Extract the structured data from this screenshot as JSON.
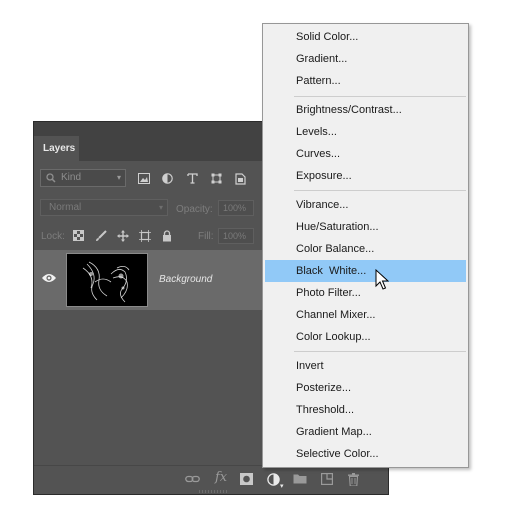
{
  "layers_panel": {
    "tab_label": "Layers",
    "filter": {
      "kind_placeholder": "Kind"
    },
    "blend_mode": "Normal",
    "opacity_label": "Opacity:",
    "opacity_value": "100%",
    "lock_label": "Lock:",
    "fill_label": "Fill:",
    "fill_value": "100%",
    "layers": [
      {
        "name": "Background",
        "visible": true,
        "selected": true
      }
    ]
  },
  "adjustment_menu": {
    "groups": [
      [
        "Solid Color...",
        "Gradient...",
        "Pattern..."
      ],
      [
        "Brightness/Contrast...",
        "Levels...",
        "Curves...",
        "Exposure..."
      ],
      [
        "Vibrance...",
        "Hue/Saturation...",
        "Color Balance...",
        "Black  White...",
        "Photo Filter...",
        "Channel Mixer...",
        "Color Lookup..."
      ],
      [
        "Invert",
        "Posterize...",
        "Threshold...",
        "Gradient Map...",
        "Selective Color..."
      ]
    ],
    "highlighted": "Black  White..."
  },
  "colors": {
    "panel_bg": "#535353",
    "selected_layer_bg": "#6a6a6a",
    "menu_bg": "#f0f0f0",
    "menu_highlight": "#91c9f7"
  }
}
